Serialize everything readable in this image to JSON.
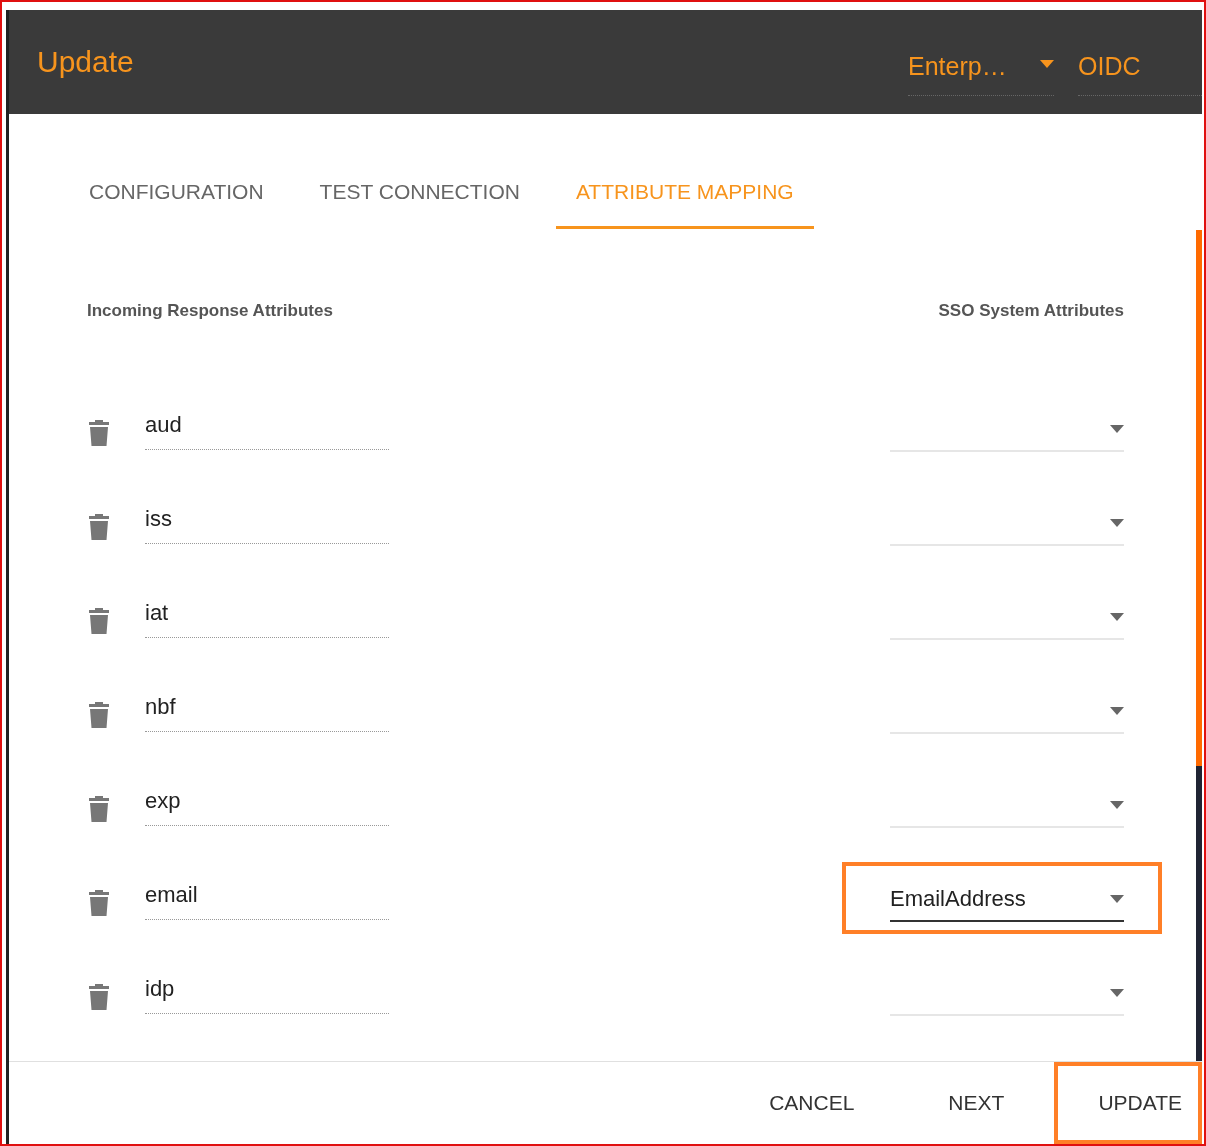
{
  "header": {
    "title": "Update",
    "selects": [
      {
        "value": "Enterp…",
        "has_caret": true
      },
      {
        "value": "OIDC",
        "has_caret": false
      }
    ]
  },
  "tabs": [
    {
      "label": "CONFIGURATION",
      "selected": false
    },
    {
      "label": "TEST CONNECTION",
      "selected": false
    },
    {
      "label": "ATTRIBUTE MAPPING",
      "selected": true
    }
  ],
  "columns": {
    "incoming": "Incoming Response Attributes",
    "sso": "SSO System Attributes"
  },
  "rows": [
    {
      "attribute": "aud",
      "mapping": "",
      "highlighted": false
    },
    {
      "attribute": "iss",
      "mapping": "",
      "highlighted": false
    },
    {
      "attribute": "iat",
      "mapping": "",
      "highlighted": false
    },
    {
      "attribute": "nbf",
      "mapping": "",
      "highlighted": false
    },
    {
      "attribute": "exp",
      "mapping": "",
      "highlighted": false
    },
    {
      "attribute": "email",
      "mapping": "EmailAddress",
      "highlighted": true
    },
    {
      "attribute": "idp",
      "mapping": "",
      "highlighted": false
    }
  ],
  "buttons": [
    {
      "label": "CANCEL",
      "highlighted": false
    },
    {
      "label": "NEXT",
      "highlighted": false
    },
    {
      "label": "UPDATE",
      "highlighted": true
    }
  ]
}
